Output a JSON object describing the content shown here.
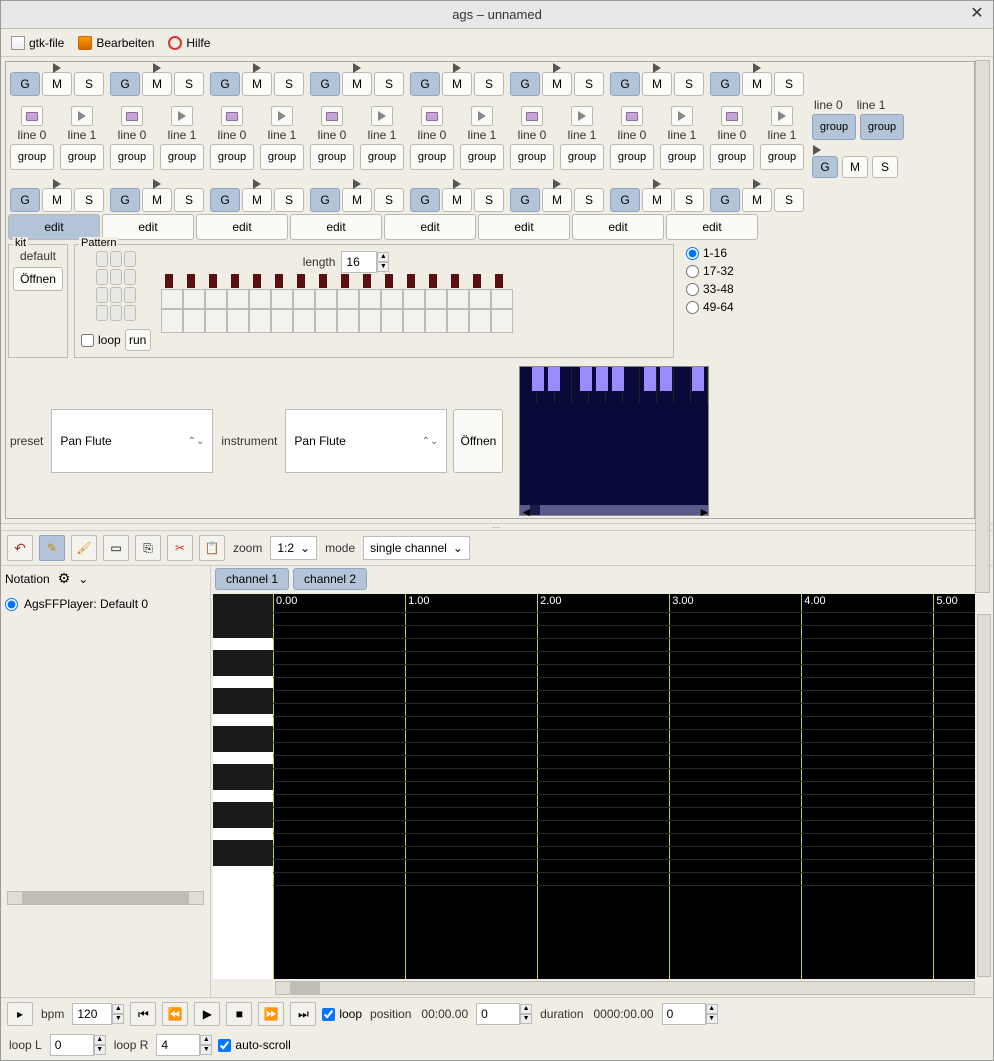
{
  "window": {
    "title": "ags – unnamed"
  },
  "menu": {
    "file": "gtk-file",
    "edit": "Bearbeiten",
    "help": "Hilfe"
  },
  "gms": {
    "g": "G",
    "m": "M",
    "s": "S"
  },
  "line": {
    "l0": "line 0",
    "l1": "line 1"
  },
  "group": "group",
  "edit_btn": "edit",
  "kit": {
    "legend": "kit",
    "default": "default",
    "open": "Öffnen"
  },
  "pattern": {
    "legend": "Pattern",
    "loop": "loop",
    "run": "run",
    "length_label": "length",
    "length": "16",
    "ranges": {
      "r1": "1-16",
      "r2": "17-32",
      "r3": "33-48",
      "r4": "49-64"
    }
  },
  "preset": {
    "preset_label": "preset",
    "preset_value": "Pan Flute",
    "instrument_label": "instrument",
    "instrument_value": "Pan Flute",
    "open": "Öffnen"
  },
  "toolbar2": {
    "zoom_label": "zoom",
    "zoom_value": "1:2",
    "mode_label": "mode",
    "mode_value": "single channel"
  },
  "notation": {
    "label": "Notation",
    "option0": "AgsFFPlayer: Default 0"
  },
  "tabs": {
    "ch1": "channel 1",
    "ch2": "channel 2"
  },
  "timeline": {
    "t0": "0.00",
    "t1": "1.00",
    "t2": "2.00",
    "t3": "3.00",
    "t4": "4.00",
    "t5": "5.00"
  },
  "transport": {
    "bpm_label": "bpm",
    "bpm": "120",
    "loop_label": "loop",
    "position_label": "position",
    "position": "00:00.00",
    "pos_offset": "0",
    "duration_label": "duration",
    "duration": "0000:00.00",
    "dur_offset": "0",
    "loopL_label": "loop L",
    "loopL": "0",
    "loopR_label": "loop R",
    "loopR": "4",
    "autoscroll": "auto-scroll"
  },
  "chart_data": {
    "type": "table",
    "description": "Piano-roll editor — empty, no notes placed",
    "time_ticks": [
      0.0,
      1.0,
      2.0,
      3.0,
      4.0,
      5.0
    ]
  }
}
